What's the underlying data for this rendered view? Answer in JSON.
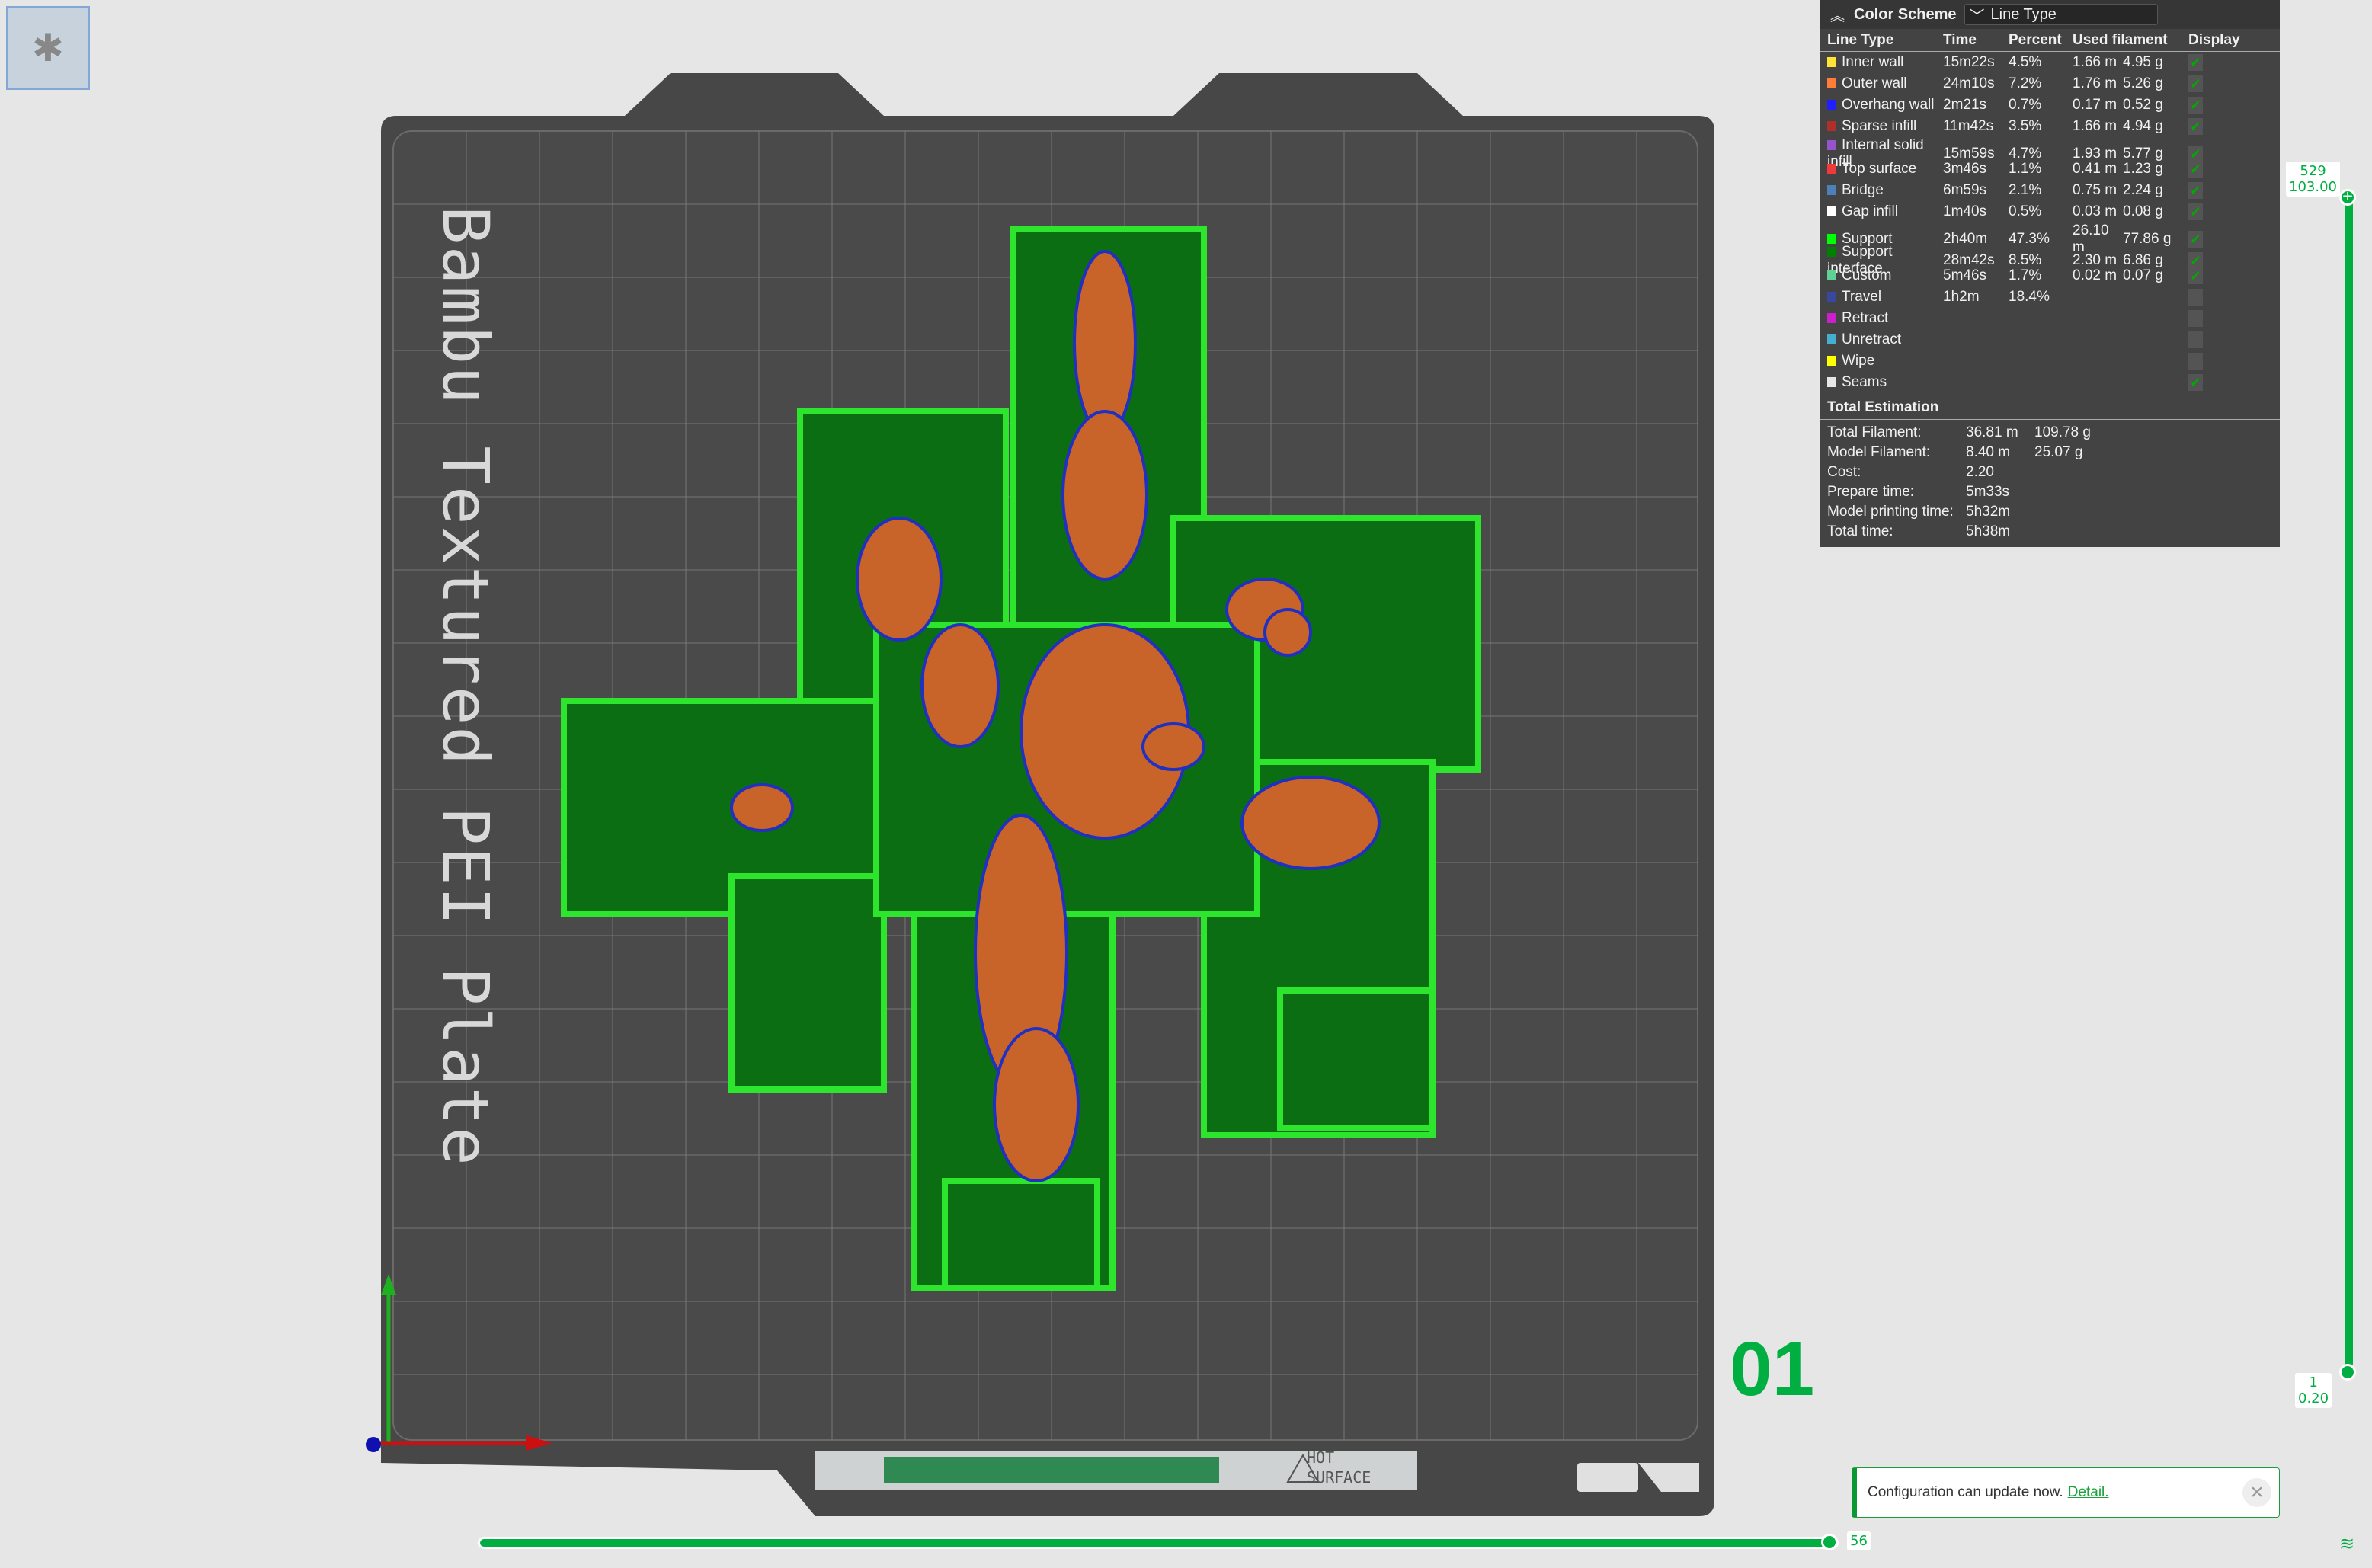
{
  "bed": {
    "label": "Bambu Textured PEI Plate",
    "plate_number": "01",
    "bed_decal": "HOT SURFACE"
  },
  "legend": {
    "title": "Color Scheme",
    "scheme": "Line Type",
    "headers": [
      "Line Type",
      "Time",
      "Percent",
      "Used filament",
      "Display"
    ],
    "items": [
      {
        "name": "Inner wall",
        "time": "15m22s",
        "percent": "4.5%",
        "length": "1.66 m",
        "weight": "4.95 g",
        "color": "#ffe433",
        "display": true
      },
      {
        "name": "Outer wall",
        "time": "24m10s",
        "percent": "7.2%",
        "length": "1.76 m",
        "weight": "5.26 g",
        "color": "#ff7d38",
        "display": true
      },
      {
        "name": "Overhang wall",
        "time": "2m21s",
        "percent": "0.7%",
        "length": "0.17 m",
        "weight": "0.52 g",
        "color": "#1f1fff",
        "display": true
      },
      {
        "name": "Sparse infill",
        "time": "11m42s",
        "percent": "3.5%",
        "length": "1.66 m",
        "weight": "4.94 g",
        "color": "#b03029",
        "display": true
      },
      {
        "name": "Internal solid infill",
        "time": "15m59s",
        "percent": "4.7%",
        "length": "1.93 m",
        "weight": "5.77 g",
        "color": "#9654cc",
        "display": true
      },
      {
        "name": "Top surface",
        "time": "3m46s",
        "percent": "1.1%",
        "length": "0.41 m",
        "weight": "1.23 g",
        "color": "#f03a3a",
        "display": true
      },
      {
        "name": "Bridge",
        "time": "6m59s",
        "percent": "2.1%",
        "length": "0.75 m",
        "weight": "2.24 g",
        "color": "#4d80ba",
        "display": true
      },
      {
        "name": "Gap infill",
        "time": "1m40s",
        "percent": "0.5%",
        "length": "0.03 m",
        "weight": "0.08 g",
        "color": "#ffffff",
        "display": true
      },
      {
        "name": "Support",
        "time": "2h40m",
        "percent": "47.3%",
        "length": "26.10 m",
        "weight": "77.86 g",
        "color": "#00ff00",
        "display": true
      },
      {
        "name": "Support interface",
        "time": "28m42s",
        "percent": "8.5%",
        "length": "2.30 m",
        "weight": "6.86 g",
        "color": "#008000",
        "display": true
      },
      {
        "name": "Custom",
        "time": "5m46s",
        "percent": "1.7%",
        "length": "0.02 m",
        "weight": "0.07 g",
        "color": "#5ed194",
        "display": true
      },
      {
        "name": "Travel",
        "time": "1h2m",
        "percent": "18.4%",
        "length": "",
        "weight": "",
        "color": "#38489e",
        "display": false
      },
      {
        "name": "Retract",
        "time": "",
        "percent": "",
        "length": "",
        "weight": "",
        "color": "#cc1fcc",
        "display": false
      },
      {
        "name": "Unretract",
        "time": "",
        "percent": "",
        "length": "",
        "weight": "",
        "color": "#45aed1",
        "display": false
      },
      {
        "name": "Wipe",
        "time": "",
        "percent": "",
        "length": "",
        "weight": "",
        "color": "#ffff00",
        "display": false
      },
      {
        "name": "Seams",
        "time": "",
        "percent": "",
        "length": "",
        "weight": "",
        "color": "#e6e6e6",
        "display": true
      }
    ],
    "total": {
      "title": "Total Estimation",
      "rows": [
        {
          "label": "Total Filament:",
          "v1": "36.81 m",
          "v2": "109.78 g"
        },
        {
          "label": "Model Filament:",
          "v1": "8.40 m",
          "v2": "25.07 g"
        },
        {
          "label": "Cost:",
          "v1": "2.20",
          "v2": ""
        },
        {
          "label": "Prepare time:",
          "v1": "5m33s",
          "v2": ""
        },
        {
          "label": "Model printing time:",
          "v1": "5h32m",
          "v2": ""
        },
        {
          "label": "Total time:",
          "v1": "5h38m",
          "v2": ""
        }
      ]
    }
  },
  "layer_slider": {
    "top_layer": "529",
    "top_height": "103.00",
    "bottom_layer": "1",
    "bottom_height": "0.20"
  },
  "move_slider": {
    "value": "56"
  },
  "notification": {
    "text": "Configuration can update now.",
    "link": "Detail."
  },
  "colors": {
    "accent": "#00ae42",
    "bed": "#474747"
  }
}
